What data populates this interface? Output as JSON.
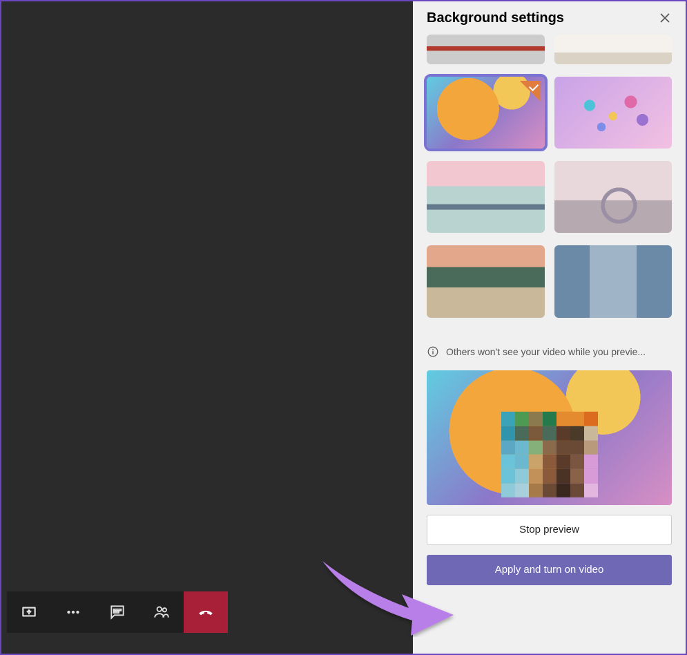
{
  "panel": {
    "title": "Background settings",
    "info_text": "Others won't see your video while you previe...",
    "stop_preview_label": "Stop preview",
    "apply_label": "Apply and turn on video"
  },
  "backgrounds": [
    {
      "id": "lobby",
      "selected": false
    },
    {
      "id": "room",
      "selected": false
    },
    {
      "id": "balloon",
      "selected": true
    },
    {
      "id": "bubbles",
      "selected": false
    },
    {
      "id": "bridge",
      "selected": false
    },
    {
      "id": "arch",
      "selected": false
    },
    {
      "id": "class",
      "selected": false
    },
    {
      "id": "lab",
      "selected": false
    }
  ],
  "toolbar": {
    "share": "share-screen",
    "more": "more-actions",
    "chat": "chat",
    "people": "participants",
    "hangup": "hang-up"
  }
}
